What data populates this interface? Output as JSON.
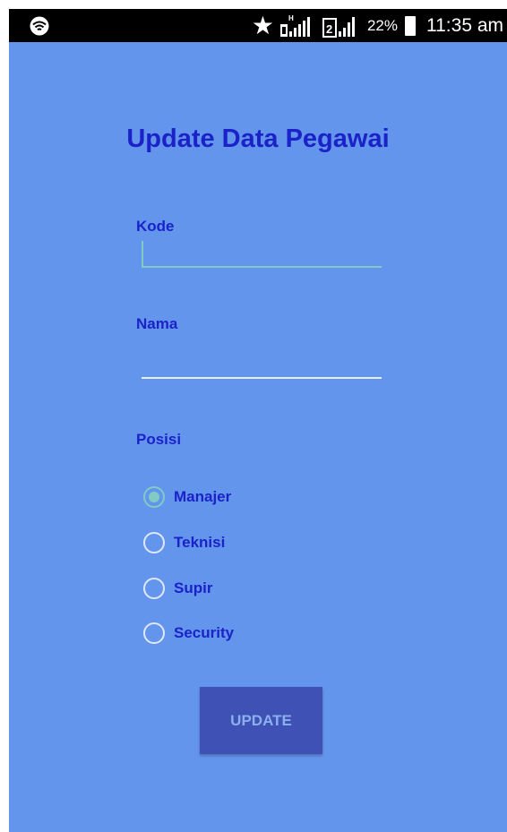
{
  "status_bar": {
    "icons": [
      "wifi-icon",
      "star-icon",
      "signal-h-icon",
      "signal-2-icon",
      "battery-icon"
    ],
    "battery_percent": "22%",
    "time": "11:35 am"
  },
  "form": {
    "title": "Update Data Pegawai",
    "kode": {
      "label": "Kode",
      "value": ""
    },
    "nama": {
      "label": "Nama",
      "value": ""
    },
    "posisi": {
      "label": "Posisi",
      "options": [
        "Manajer",
        "Teknisi",
        "Supir",
        "Security"
      ],
      "selected": "Manajer"
    },
    "update_label": "UPDATE"
  },
  "colors": {
    "background": "#6495ed",
    "text": "#1a22c8",
    "accent": "#80cbc4",
    "button": "#3f51b5",
    "button_text": "#8ab0ee"
  }
}
